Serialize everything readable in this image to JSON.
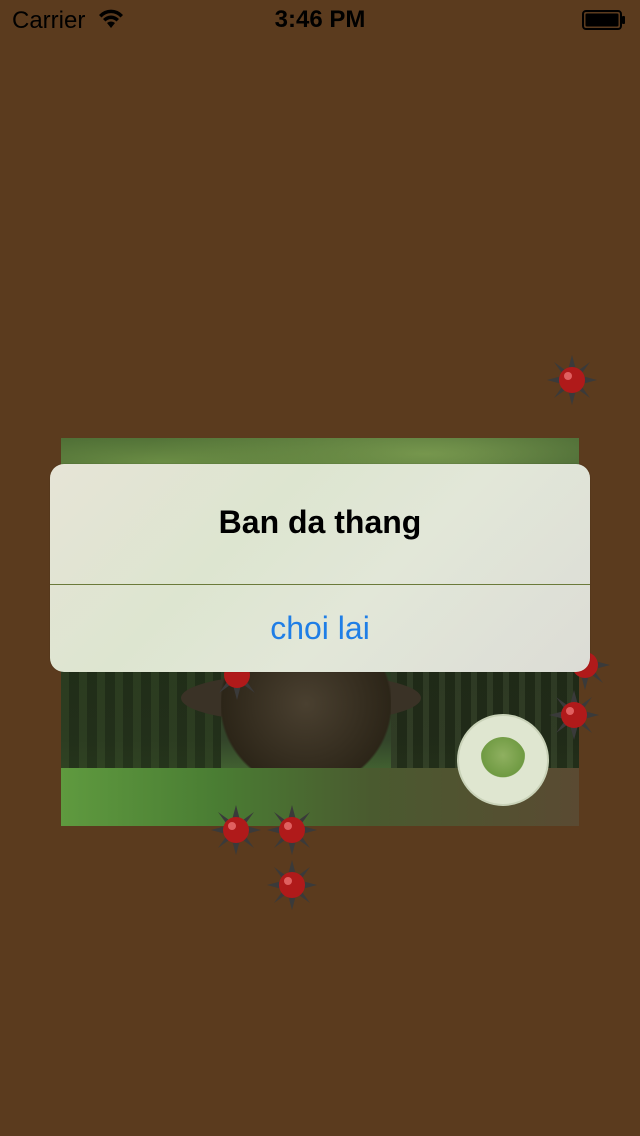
{
  "status_bar": {
    "carrier": "Carrier",
    "time": "3:46 PM",
    "icons": [
      "wifi-icon",
      "battery-icon"
    ]
  },
  "scene": {
    "image": "forest-tree-image",
    "logo": "tree-logo-badge"
  },
  "alert": {
    "title": "Ban da thang",
    "button_label": "choi lai",
    "button_color": "#1f7ee6"
  },
  "colors": {
    "background": "#5b3b1e",
    "mine_red": "#b01a1a"
  },
  "mines_count": 7
}
